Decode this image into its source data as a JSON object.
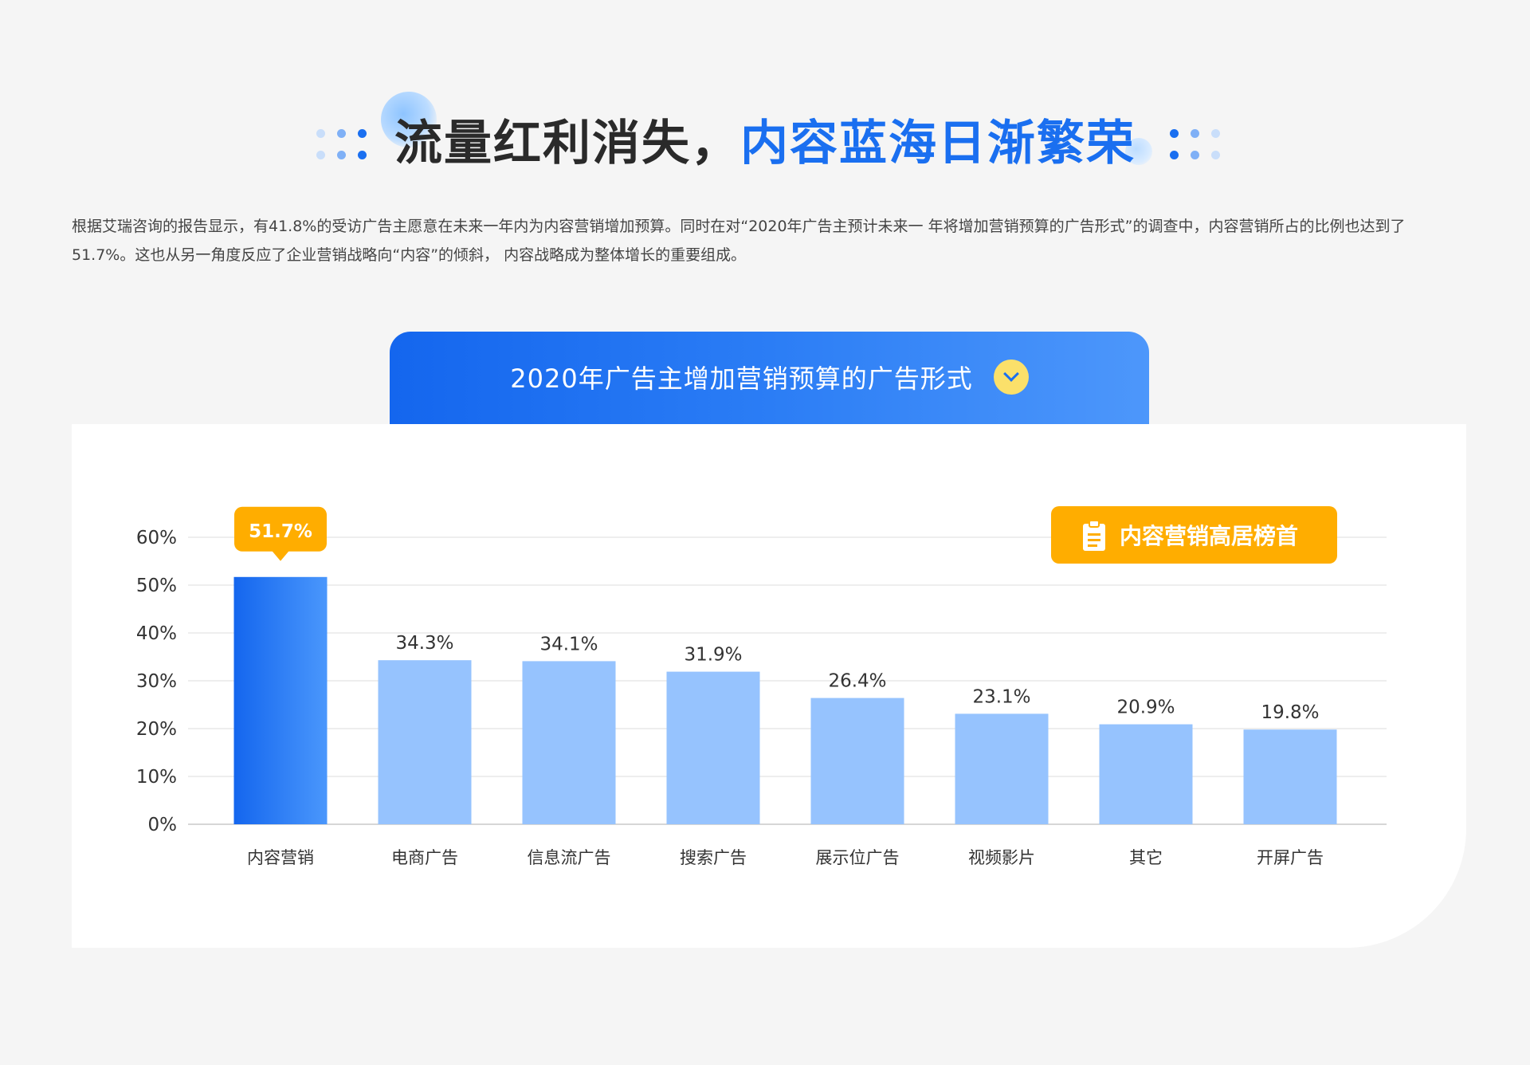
{
  "header": {
    "title_part1": "流量红利消失，",
    "title_part2": "内容蓝海日渐繁荣"
  },
  "description": "根据艾瑞咨询的报告显示，有41.8%的受访广告主愿意在未来一年内为内容营销增加预算。同时在对“2020年广告主预计未来一 年将增加营销预算的广告形式”的调查中，内容营销所占的比例也达到了51.7%。这也从另一角度反应了企业营销战略向“内容”的倾斜， 内容战略成为整体增长的重要组成。",
  "chart_tab": {
    "title": "2020年广告主增加营销预算的广告形式",
    "icon": "chevron-down-icon"
  },
  "badge": {
    "label": "内容营销高居榜首",
    "icon": "clipboard-icon",
    "color": "#ffad00"
  },
  "colors": {
    "accent_blue": "#1a6ff0",
    "bar_light": "#96c3fe",
    "highlight_label": "#ffad00"
  },
  "chart_data": {
    "type": "bar",
    "categories": [
      "内容营销",
      "电商广告",
      "信息流广告",
      "搜索广告",
      "展示位广告",
      "视频影片",
      "其它",
      "开屏广告"
    ],
    "values": [
      51.7,
      34.3,
      34.1,
      31.9,
      26.4,
      23.1,
      20.9,
      19.8
    ],
    "value_labels": [
      "51.7%",
      "34.3%",
      "34.1%",
      "31.9%",
      "26.4%",
      "23.1%",
      "20.9%",
      "19.8%"
    ],
    "highlight_index": 0,
    "ylim": [
      0,
      60
    ],
    "yticks": [
      0,
      10,
      20,
      30,
      40,
      50,
      60
    ],
    "ytick_labels": [
      "0%",
      "10%",
      "20%",
      "30%",
      "40%",
      "50%",
      "60%"
    ],
    "title": "",
    "xlabel": "",
    "ylabel": "",
    "grid": true
  }
}
